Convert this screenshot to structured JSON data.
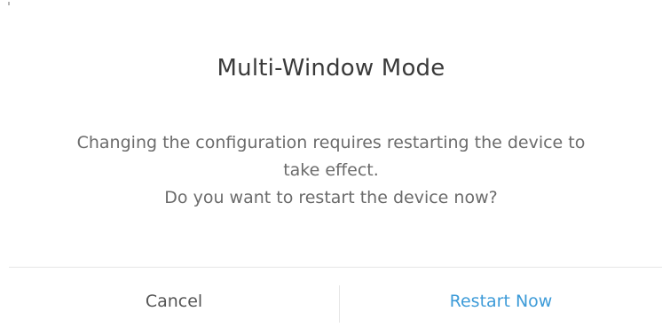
{
  "dialog": {
    "title": "Multi-Window Mode",
    "message_lines": [
      "Changing the configuration requires restarting the device to",
      "take effect.",
      "Do you want to restart the device now?"
    ],
    "buttons": {
      "cancel_label": "Cancel",
      "confirm_label": "Restart Now"
    }
  },
  "colors": {
    "confirm_accent": "#3d9bd8",
    "title_text": "#3a3a3a",
    "message_text": "#6b6b6b"
  }
}
